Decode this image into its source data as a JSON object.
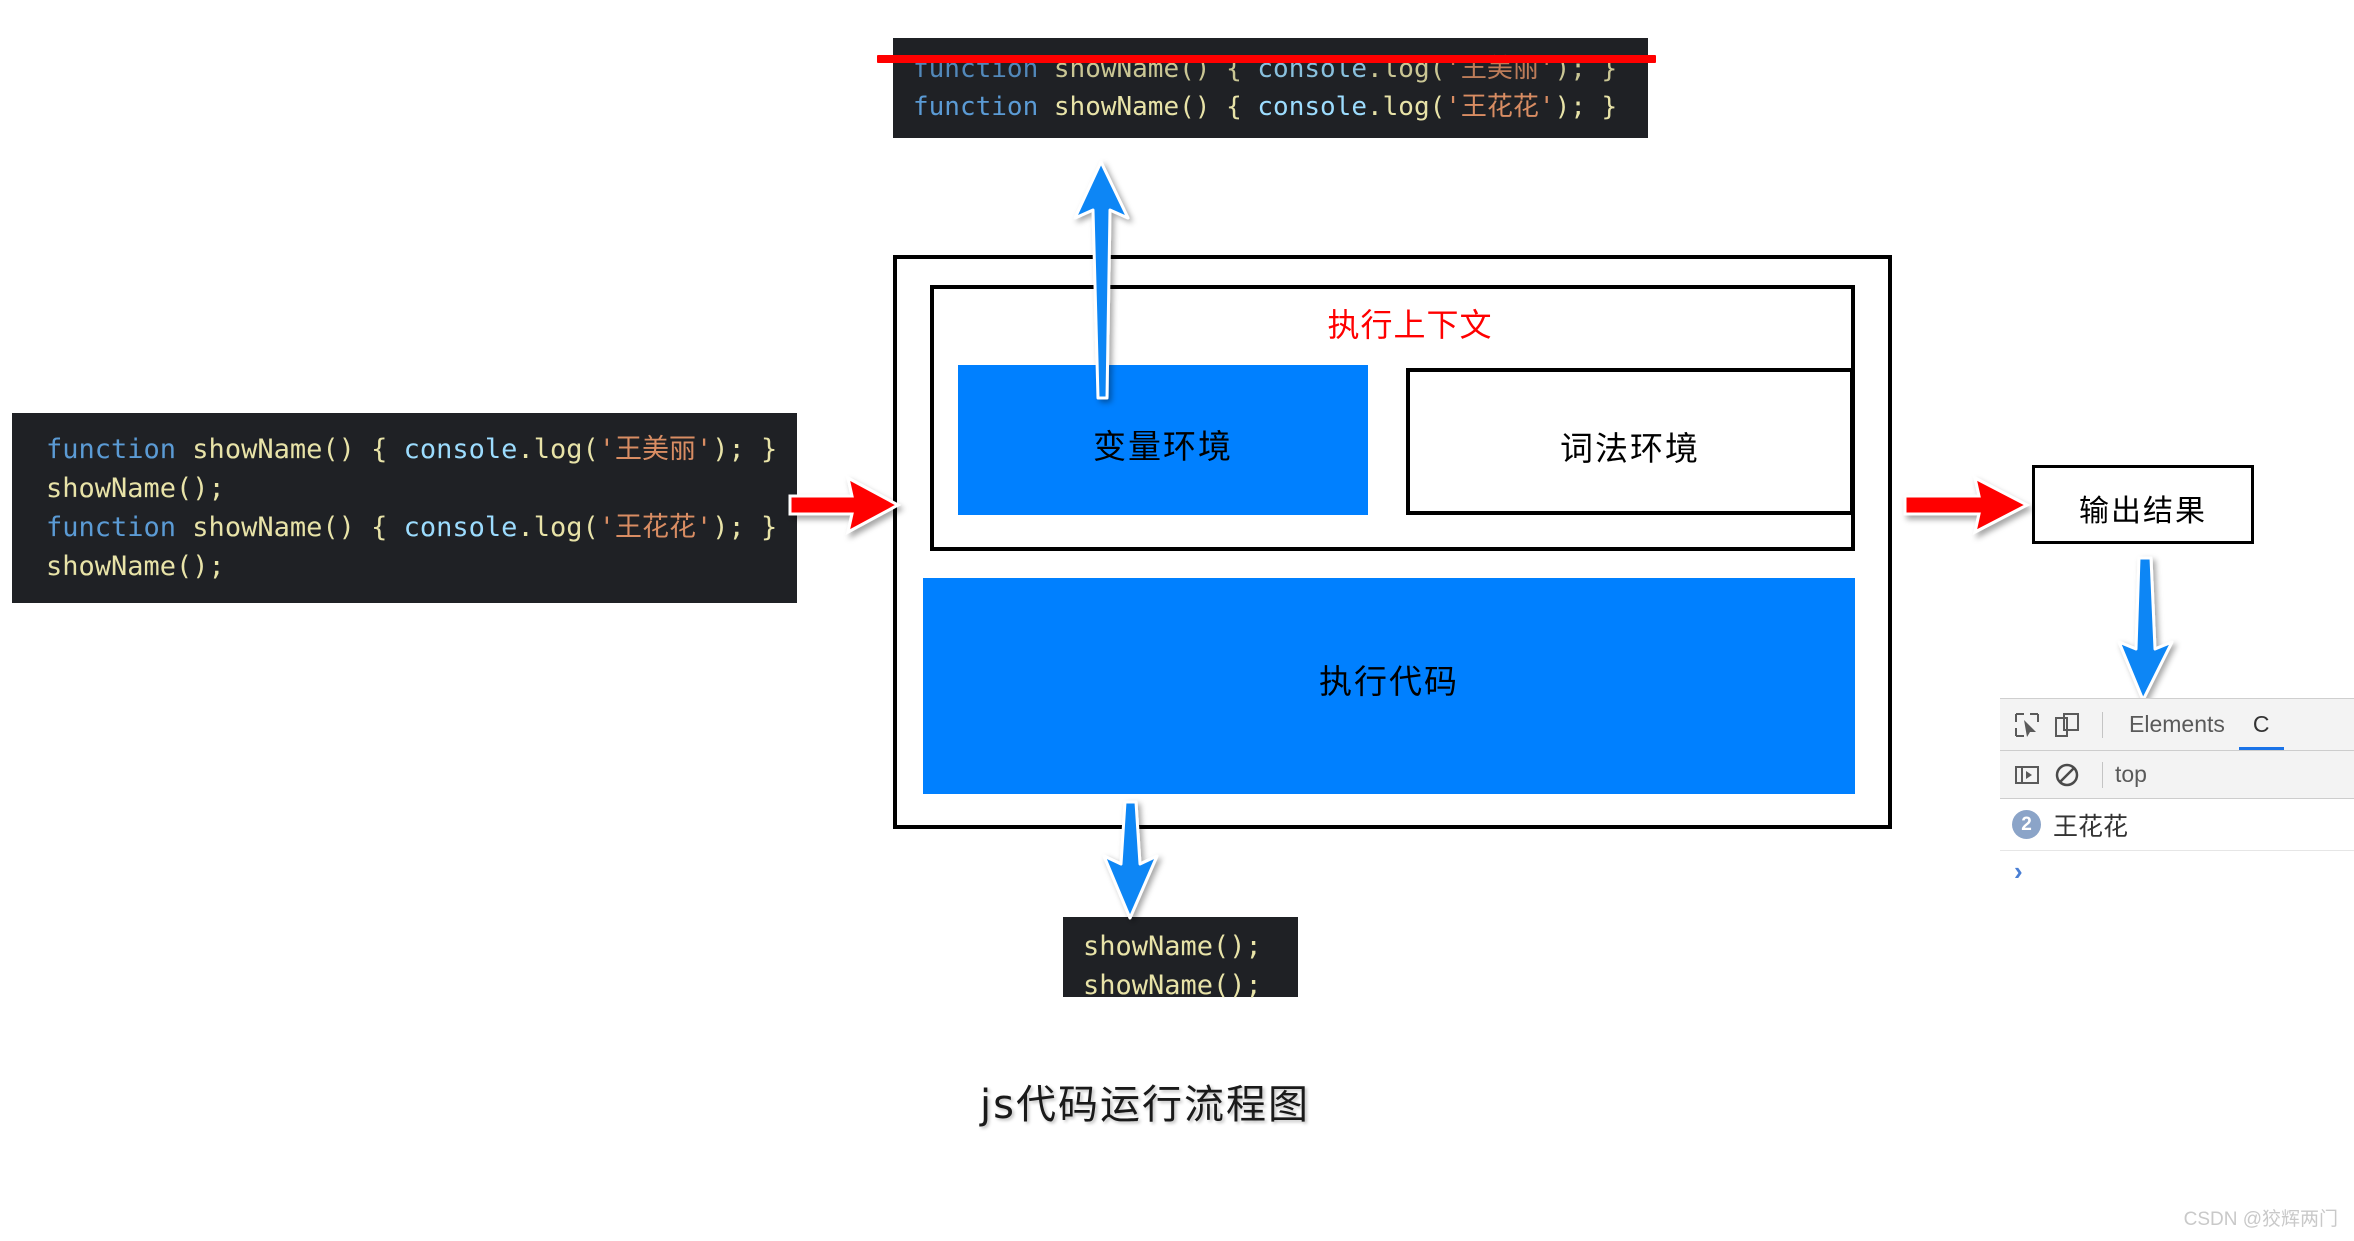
{
  "top_code": {
    "lines": [
      {
        "struck": true,
        "tokens": [
          {
            "t": "function",
            "c": "kw"
          },
          {
            "t": " showName",
            "c": "fn"
          },
          {
            "t": "() { ",
            "c": "punc"
          },
          {
            "t": "console",
            "c": "obj"
          },
          {
            "t": ".log(",
            "c": "punc"
          },
          {
            "t": "'王美丽'",
            "c": "str"
          },
          {
            "t": "); }",
            "c": "punc"
          }
        ]
      },
      {
        "struck": false,
        "tokens": [
          {
            "t": "function",
            "c": "kw"
          },
          {
            "t": " showName",
            "c": "fn"
          },
          {
            "t": "() { ",
            "c": "punc"
          },
          {
            "t": "console",
            "c": "obj"
          },
          {
            "t": ".log(",
            "c": "punc"
          },
          {
            "t": "'王花花'",
            "c": "str"
          },
          {
            "t": "); }",
            "c": "punc"
          }
        ]
      }
    ]
  },
  "left_code": {
    "lines": [
      {
        "struck": false,
        "tokens": [
          {
            "t": "function",
            "c": "kw"
          },
          {
            "t": " showName",
            "c": "fn"
          },
          {
            "t": "() { ",
            "c": "punc"
          },
          {
            "t": "console",
            "c": "obj"
          },
          {
            "t": ".log(",
            "c": "punc"
          },
          {
            "t": "'王美丽'",
            "c": "str"
          },
          {
            "t": "); }",
            "c": "punc"
          }
        ]
      },
      {
        "struck": false,
        "tokens": [
          {
            "t": "showName();",
            "c": "plain"
          }
        ]
      },
      {
        "struck": false,
        "tokens": [
          {
            "t": "function",
            "c": "kw"
          },
          {
            "t": " showName",
            "c": "fn"
          },
          {
            "t": "() { ",
            "c": "punc"
          },
          {
            "t": "console",
            "c": "obj"
          },
          {
            "t": ".log(",
            "c": "punc"
          },
          {
            "t": "'王花花'",
            "c": "str"
          },
          {
            "t": "); }",
            "c": "punc"
          }
        ]
      },
      {
        "struck": false,
        "tokens": [
          {
            "t": "showName();",
            "c": "plain"
          }
        ]
      }
    ]
  },
  "bottom_code": {
    "lines": [
      {
        "struck": false,
        "tokens": [
          {
            "t": "showName();",
            "c": "plain"
          }
        ]
      },
      {
        "struck": false,
        "tokens": [
          {
            "t": "showName();",
            "c": "plain"
          }
        ]
      }
    ]
  },
  "execution_context": {
    "title": "执行上下文",
    "variable_environment_label": "变量环境",
    "lexical_environment_label": "词法环境",
    "execution_code_label": "执行代码"
  },
  "output": {
    "label": "输出结果"
  },
  "devtools": {
    "tabs": [
      {
        "label": "Elements",
        "active": false
      },
      {
        "label": "C",
        "active": true
      }
    ],
    "context_selector": "top",
    "console_message": {
      "count": "2",
      "text": "王花花"
    },
    "prompt_symbol": "›",
    "icons": {
      "inspect": "inspect-element-icon",
      "device": "device-toolbar-icon",
      "sidebar": "console-sidebar-icon",
      "clear": "clear-console-icon"
    }
  },
  "diagram": {
    "title": "js代码运行流程图"
  },
  "watermark": {
    "text": "CSDN @狡辉两门"
  },
  "colors": {
    "blue_box": "#0080ff",
    "red_accent": "#ff0000",
    "code_bg": "#1f2125",
    "devtools_accent": "#1a73e8"
  },
  "chart_data": null
}
